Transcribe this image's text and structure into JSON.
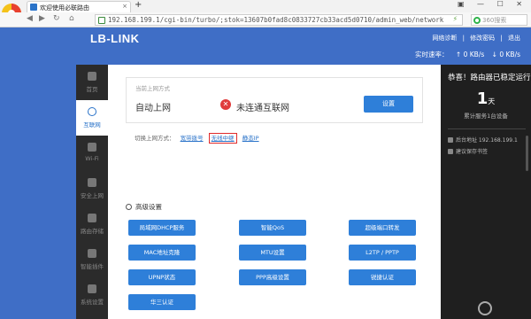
{
  "browser": {
    "tab_title": "欢迎使用必联路由",
    "tab_close": "×",
    "new_tab": "+",
    "window_controls": "▣ — ☐ ✕",
    "back": "◀",
    "forward": "▶",
    "refresh": "↻",
    "home": "⌂",
    "url": "192.168.199.1/cgi-bin/turbo/;stok=13607b0fad8c0833727cb33acd5d0710/admin_web/network",
    "search_placeholder": "360搜索"
  },
  "header": {
    "brand": "LB-LINK",
    "links": [
      "网络诊断",
      "|",
      "修改密码",
      "|",
      "退出"
    ],
    "speed_label": "实时速率：",
    "upload": "0 KB/s",
    "download": "0 KB/s",
    "up_arrow": "↑",
    "down_arrow": "↓"
  },
  "sidenav": {
    "items": [
      {
        "label": "首页"
      },
      {
        "label": "互联网"
      },
      {
        "label": "Wi-Fi"
      },
      {
        "label": "安全上网"
      },
      {
        "label": "路由存储"
      },
      {
        "label": "智能插件"
      },
      {
        "label": "系统设置"
      }
    ]
  },
  "wan": {
    "caption": "当前上网方式",
    "mode": "自动上网",
    "error_glyph": "✕",
    "status": "未连通互联网",
    "set_button": "设置",
    "switch_label": "切换上网方式：",
    "options": [
      "宽带拨号",
      "无线中继",
      "静态IP"
    ]
  },
  "advanced": {
    "title": "高级设置",
    "buttons": [
      "局域网DHCP服务",
      "智能QoS",
      "超级端口转发",
      "MAC地址克隆",
      "MTU设置",
      "L2TP / PPTP",
      "UPNP状态",
      "PPP高级设置",
      "锐捷认证",
      "华三认证"
    ]
  },
  "status_panel": {
    "title": "恭喜！路由器已稳定运行",
    "days": "1",
    "days_unit": "天",
    "devices": "累计服务1台设备",
    "backend": "后台地址 192.168.199.1",
    "bookmark": "建议保存书签"
  },
  "colors": {
    "page_bg": "#3f6ec6",
    "accent": "#2e7fd9",
    "error": "#e03b3b",
    "highlight": "#e02a2a",
    "nav_bg": "#2b2b2b",
    "panel_bg": "#1f1f1f"
  }
}
